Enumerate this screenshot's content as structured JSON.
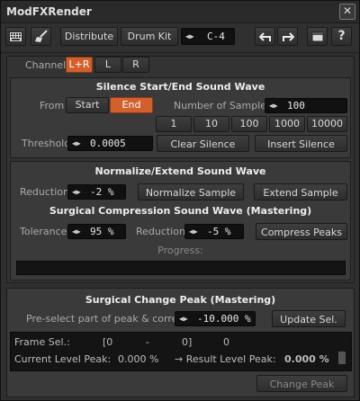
{
  "window": {
    "title": "ModFXRender",
    "close_glyph": "✕"
  },
  "toolbar": {
    "distribute": "Distribute",
    "drum_kit": "Drum Kit",
    "note_value": "C-4",
    "help": "?"
  },
  "channel": {
    "label": "Channel",
    "options": [
      "L+R",
      "L",
      "R"
    ],
    "selected": "L+R"
  },
  "silence": {
    "heading": "Silence Start/End Sound Wave",
    "from_label": "From",
    "from_options": [
      "Start",
      "End"
    ],
    "from_selected": "End",
    "samples_label": "Number of Samples",
    "samples_value": "100",
    "presets": [
      "1",
      "10",
      "100",
      "1000",
      "10000"
    ],
    "threshold_label": "Threshold",
    "threshold_value": "0.0005",
    "clear_button": "Clear Silence",
    "insert_button": "Insert Silence"
  },
  "normalize": {
    "heading": "Normalize/Extend Sound Wave",
    "reduction_label": "Reduction",
    "reduction_value": "-2 %",
    "normalize_button": "Normalize Sample",
    "extend_button": "Extend Sample"
  },
  "compression": {
    "heading": "Surgical Compression Sound Wave (Mastering)",
    "tolerance_label": "Tolerance",
    "tolerance_value": "95 %",
    "reduction_label": "Reduction",
    "reduction_value": "-5 %",
    "compress_button": "Compress Peaks",
    "progress_label": "Progress:"
  },
  "peak": {
    "heading": "Surgical Change Peak (Mastering)",
    "preselect_label": "Pre-select part of peak & correct:",
    "preselect_value": "-10.000 %",
    "update_button": "Update Sel.",
    "frame_label": "Frame Sel.:",
    "frame_open": "[0",
    "frame_dash": "-",
    "frame_close": "0]",
    "frame_count": "0",
    "current_label": "Current Level Peak:",
    "current_value": "0.000 %",
    "result_label": "→ Result Level Peak:",
    "result_value": "0.000 %",
    "change_button": "Change Peak"
  }
}
